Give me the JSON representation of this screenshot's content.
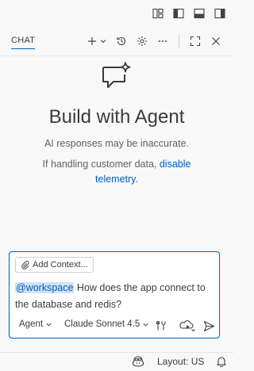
{
  "chat_tab": {
    "label": "CHAT"
  },
  "empty_state": {
    "title": "Build with Agent",
    "disclaimer": "AI responses may be inaccurate.",
    "telemetry_prefix": "If handling customer data, ",
    "telemetry_link": "disable telemetry",
    "telemetry_suffix": "."
  },
  "input": {
    "add_context_label": "Add Context...",
    "mention": "@workspace",
    "message": " How does the app connect to the database and redis?",
    "mode": "Agent",
    "model": "Claude Sonnet 4.5"
  },
  "statusbar": {
    "layout": "Layout: US"
  },
  "colors": {
    "accent": "#005fb8",
    "mention_bg": "#cce3f9",
    "background": "#f8f8f8"
  },
  "icons": [
    "layout-customize-icon",
    "toggle-primary-sidebar-icon",
    "toggle-panel-icon",
    "toggle-secondary-sidebar-icon",
    "new-chat-icon",
    "chevron-down-icon",
    "history-icon",
    "settings-icon",
    "more-icon",
    "maximize-icon",
    "close-icon",
    "agent-sparkle-icon",
    "paperclip-icon",
    "tools-icon",
    "send-menu-icon",
    "send-icon",
    "copilot-icon",
    "bell-icon"
  ]
}
